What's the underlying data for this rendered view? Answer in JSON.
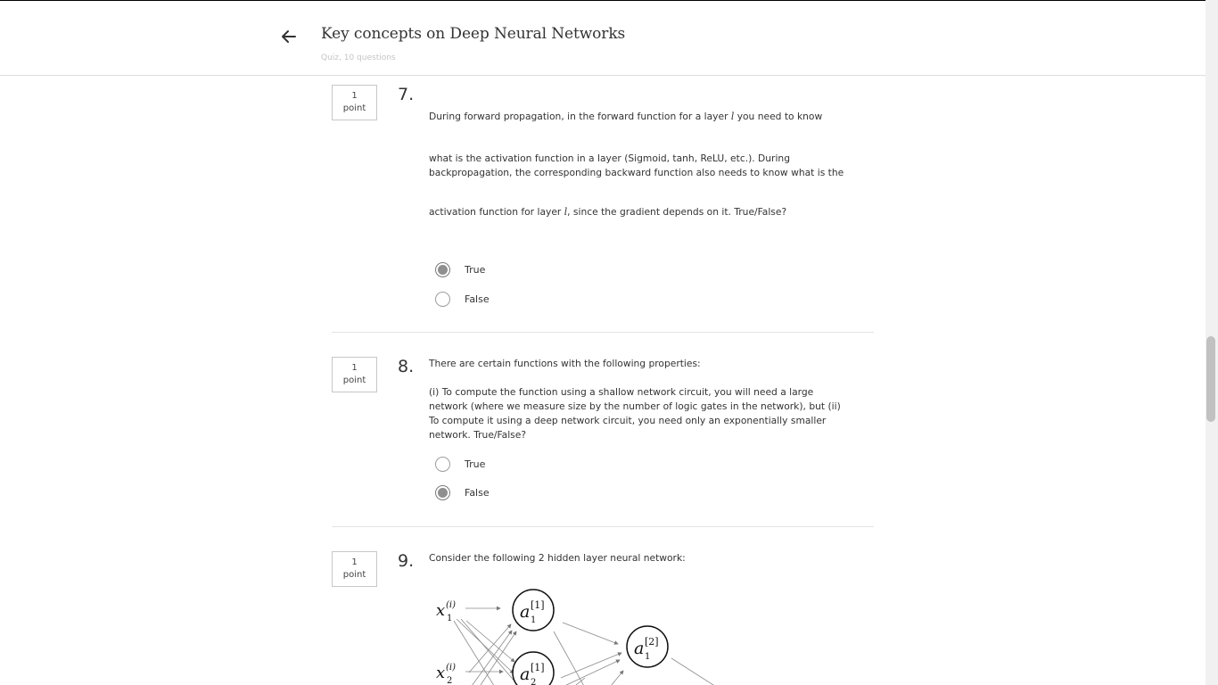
{
  "header": {
    "title": "Key concepts on Deep Neural Networks",
    "subtitle": "Quiz, 10 questions"
  },
  "questions": [
    {
      "number": "7.",
      "points_value": "1",
      "points_unit": "point",
      "text_line1": "During forward propagation, in the forward function for a layer ",
      "text_var1": "l",
      "text_line1_end": " you need to know",
      "text_para2": "what is the activation function in a layer (Sigmoid, tanh, ReLU, etc.). During backpropagation, the corresponding backward function also needs to know what is the",
      "text_line3": "activation function for layer ",
      "text_var2": "l",
      "text_line3_end": ", since the gradient depends on it. True/False?",
      "options": [
        {
          "label": "True",
          "selected": true
        },
        {
          "label": "False",
          "selected": false
        }
      ]
    },
    {
      "number": "8.",
      "points_value": "1",
      "points_unit": "point",
      "text_para1": "There are certain functions with the following properties:",
      "text_para2": "(i) To compute the function using a shallow network circuit, you will need a large network (where we measure size by the number of logic gates in the network), but (ii) To compute it using a deep network circuit, you need only an exponentially smaller network. True/False?",
      "options": [
        {
          "label": "True",
          "selected": false
        },
        {
          "label": "False",
          "selected": true
        }
      ]
    },
    {
      "number": "9.",
      "points_value": "1",
      "points_unit": "point",
      "text_para1": "Consider the following 2 hidden layer neural network:",
      "diagram": {
        "inputs": [
          {
            "base": "x",
            "sub": "1",
            "sup": "(i)"
          },
          {
            "base": "x",
            "sub": "2",
            "sup": "(i)"
          }
        ],
        "layer1": [
          {
            "base": "a",
            "sub": "1",
            "sup": "[1]"
          },
          {
            "base": "a",
            "sub": "2",
            "sup": "[1]"
          }
        ],
        "layer2": [
          {
            "base": "a",
            "sub": "1",
            "sup": "[2]"
          }
        ]
      }
    }
  ]
}
